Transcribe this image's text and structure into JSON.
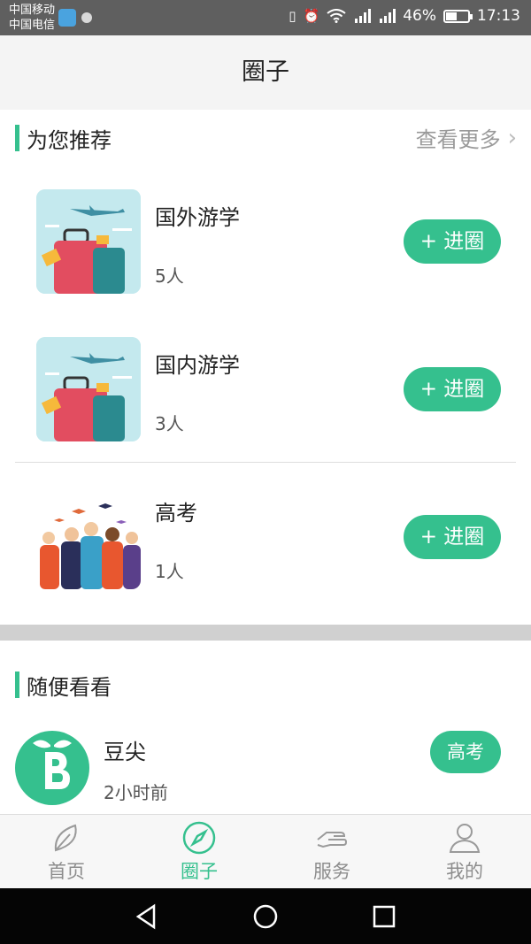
{
  "status_bar": {
    "carrier_1": "中国移动",
    "carrier_2": "中国电信",
    "battery_percent": "46%",
    "battery_level": 0.46,
    "time": "17:13",
    "icons": [
      "vibrate-icon",
      "alarm-icon",
      "wifi-icon",
      "signal-2g-icon",
      "signal-3g-icon",
      "battery-icon"
    ]
  },
  "header": {
    "title": "圈子"
  },
  "recommend": {
    "title": "为您推荐",
    "more_label": "查看更多",
    "items": [
      {
        "name": "国外游学",
        "count": "5人",
        "join_label": "+ 进圈",
        "image": "luggage-travel-image"
      },
      {
        "name": "国内游学",
        "count": "3人",
        "join_label": "+ 进圈",
        "image": "luggage-travel-image"
      },
      {
        "name": "高考",
        "count": "1人",
        "join_label": "+ 进圈",
        "image": "graduation-celebration-image"
      }
    ]
  },
  "random": {
    "title": "随便看看",
    "items": [
      {
        "name": "豆尖",
        "time": "2小时前",
        "tag": "高考",
        "avatar": "doujian-logo"
      }
    ]
  },
  "tabbar": {
    "items": [
      {
        "label": "首页",
        "icon": "leaf-icon",
        "active": false
      },
      {
        "label": "圈子",
        "icon": "compass-icon",
        "active": true
      },
      {
        "label": "服务",
        "icon": "hand-icon",
        "active": false
      },
      {
        "label": "我的",
        "icon": "person-icon",
        "active": false
      }
    ]
  },
  "colors": {
    "accent": "#35c08e",
    "status_bar": "#5f5f5f",
    "system_nav": "#050505"
  }
}
